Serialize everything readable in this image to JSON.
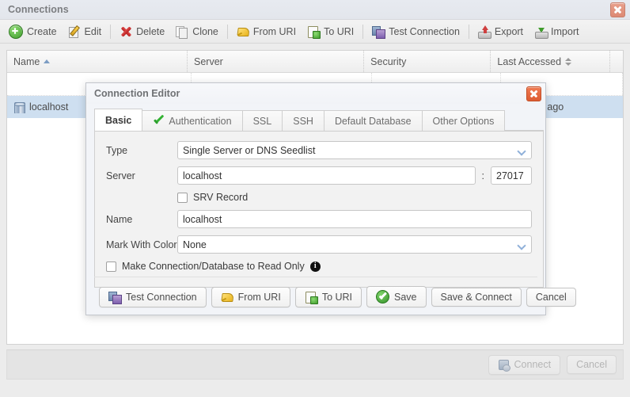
{
  "window": {
    "title": "Connections",
    "close_icon": "close-icon"
  },
  "toolbar": {
    "items": [
      {
        "label": "Create",
        "icon": "plus-circle-icon"
      },
      {
        "label": "Edit",
        "icon": "pencil-notepad-icon"
      },
      {
        "label": "Delete",
        "icon": "red-x-icon"
      },
      {
        "label": "Clone",
        "icon": "copy-documents-icon"
      },
      {
        "label": "From URI",
        "icon": "yellow-import-icon"
      },
      {
        "label": "To URI",
        "icon": "clipboard-plus-icon"
      },
      {
        "label": "Test Connection",
        "icon": "two-windows-icon"
      },
      {
        "label": "Export",
        "icon": "disk-up-arrow-icon"
      },
      {
        "label": "Import",
        "icon": "disk-down-arrow-icon"
      }
    ]
  },
  "table": {
    "columns": [
      {
        "label": "Name",
        "sort": "asc"
      },
      {
        "label": "Server",
        "sort": "none"
      },
      {
        "label": "Security",
        "sort": "none"
      },
      {
        "label": "Last Accessed",
        "sort": "both"
      }
    ],
    "rows": [
      {
        "name": "localhost",
        "server": "",
        "security": "",
        "last_accessed": "seconds ago",
        "icon": "database-icon",
        "selected": true
      }
    ]
  },
  "window_footer": {
    "connect_label": "Connect",
    "connect_icon": "database-connect-icon",
    "cancel_label": "Cancel"
  },
  "dialog": {
    "title": "Connection Editor",
    "close_icon": "close-icon",
    "tabs": [
      {
        "label": "Basic",
        "active": true,
        "icon": null
      },
      {
        "label": "Authentication",
        "active": false,
        "icon": "green-check-icon"
      },
      {
        "label": "SSL",
        "active": false,
        "icon": null
      },
      {
        "label": "SSH",
        "active": false,
        "icon": null
      },
      {
        "label": "Default Database",
        "active": false,
        "icon": null
      },
      {
        "label": "Other Options",
        "active": false,
        "icon": null
      }
    ],
    "form": {
      "type_label": "Type",
      "type_value": "Single Server or DNS Seedlist",
      "server_label": "Server",
      "server_value": "localhost",
      "server_placeholder": "",
      "port_separator": ":",
      "port_value": "27017",
      "srv_label": "SRV Record",
      "srv_checked": false,
      "name_label": "Name",
      "name_value": "localhost",
      "name_placeholder": "",
      "color_label": "Mark With Color",
      "color_value": "None",
      "readonly_label": "Make Connection/Database to Read Only",
      "readonly_checked": false,
      "readonly_info_icon": "info-icon"
    },
    "footer": {
      "test_label": "Test Connection",
      "test_icon": "two-windows-icon",
      "from_uri_label": "From URI",
      "from_uri_icon": "yellow-import-icon",
      "to_uri_label": "To URI",
      "to_uri_icon": "clipboard-plus-icon",
      "save_label": "Save",
      "save_icon": "green-check-circle-icon",
      "save_connect_label": "Save & Connect",
      "cancel_label": "Cancel"
    }
  },
  "colors": {
    "accent": "#8fb0d9",
    "selection": "#cedff0",
    "close_red": "#dd5c32",
    "ok_green": "#35922a",
    "danger_red": "#b62020"
  }
}
